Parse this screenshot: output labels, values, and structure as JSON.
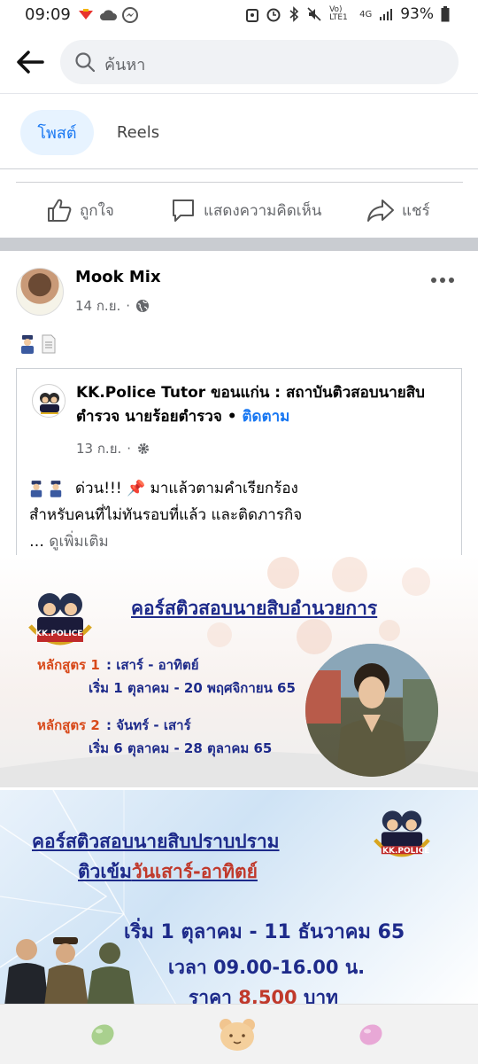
{
  "status_bar": {
    "time": "09:09",
    "battery": "93%",
    "icons": [
      "app-notification-icon",
      "cloud-icon",
      "messenger-icon",
      "security-icon",
      "alarm-icon",
      "bluetooth-icon",
      "mute-icon",
      "volte-icon",
      "signal-icon",
      "battery-icon"
    ],
    "network_label": "Vo) LTE1",
    "network_gen": "4G"
  },
  "search": {
    "placeholder": "ค้นหา"
  },
  "tabs": [
    {
      "label": "โพสต์",
      "active": true
    },
    {
      "label": "Reels",
      "active": false
    }
  ],
  "actions": {
    "like": "ถูกใจ",
    "comment": "แสดงความคิดเห็น",
    "share": "แชร์"
  },
  "post": {
    "author": "Mook Mix",
    "date": "14 ก.ย.",
    "separator": "·",
    "shared": {
      "page_name": "KK.Police Tutor ขอนแก่น : สถาบันติวสอบนายสิบตำรวจ นายร้อยตำรวจ",
      "dot": "•",
      "follow": "ติดตาม",
      "date": "13 ก.ย.",
      "text_line1": "ด่วน!!! 📌 มาแล้วตามคำเรียกร้อง",
      "text_line2": "สำหรับคนที่ไม่ทันรอบที่แล้ว และติดภารกิจ",
      "ellipsis": "…",
      "see_more": "ดูเพิ่มเติม"
    }
  },
  "banner1": {
    "logo_text": "KK.POLICE",
    "title": "คอร์สติวสอบนายสิบอำนวยการ",
    "course1_label": "หลักสูตร 1",
    "course1_days": ": เสาร์ - อาทิตย์",
    "course1_dates": "เริ่ม 1 ตุลาคม - 20 พฤศจิกายน 65",
    "course2_label": "หลักสูตร 2",
    "course2_days": ": จันทร์ - เสาร์",
    "course2_dates": "เริ่ม 6 ตุลาคม - 28 ตุลาคม 65"
  },
  "banner2": {
    "logo_text": "KK.POLICE",
    "title1": "คอร์สติวสอบนายสิบปราบปราม",
    "title2_a": "ติวเข้ม",
    "title2_b": "วันเสาร์-อาทิตย์",
    "dates": "เริ่ม 1 ตุลาคม - 11 ธันวาคม 65",
    "time": "เวลา 09.00-16.00 น.",
    "price_a": "ราคา",
    "price_num": "8,500",
    "price_b": "บาท"
  },
  "bottom_nav": [
    "green-jellybean-icon",
    "bear-face-icon",
    "pink-jellybean-icon"
  ],
  "colors": {
    "accent": "#1877f2",
    "tab_active_bg": "#e7f3ff",
    "banner_title": "#1d2a8a",
    "banner_highlight": "#d84a1b"
  }
}
